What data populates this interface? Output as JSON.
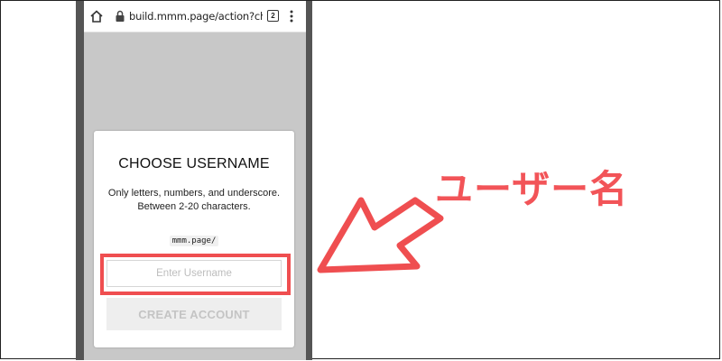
{
  "browser": {
    "url": "build.mmm.page/action?choos",
    "tab_count": "2"
  },
  "modal": {
    "title": "CHOOSE USERNAME",
    "description": "Only letters, numbers, and underscore. Between 2-20 characters.",
    "url_prefix": "mmm.page/",
    "username_placeholder": "Enter Username",
    "username_value": "",
    "create_button_label": "CREATE ACCOUNT"
  },
  "annotation": {
    "label": "ユーザー名",
    "color": "#f25458"
  },
  "icons": [
    "home-icon",
    "lock-icon",
    "menu-icon"
  ]
}
